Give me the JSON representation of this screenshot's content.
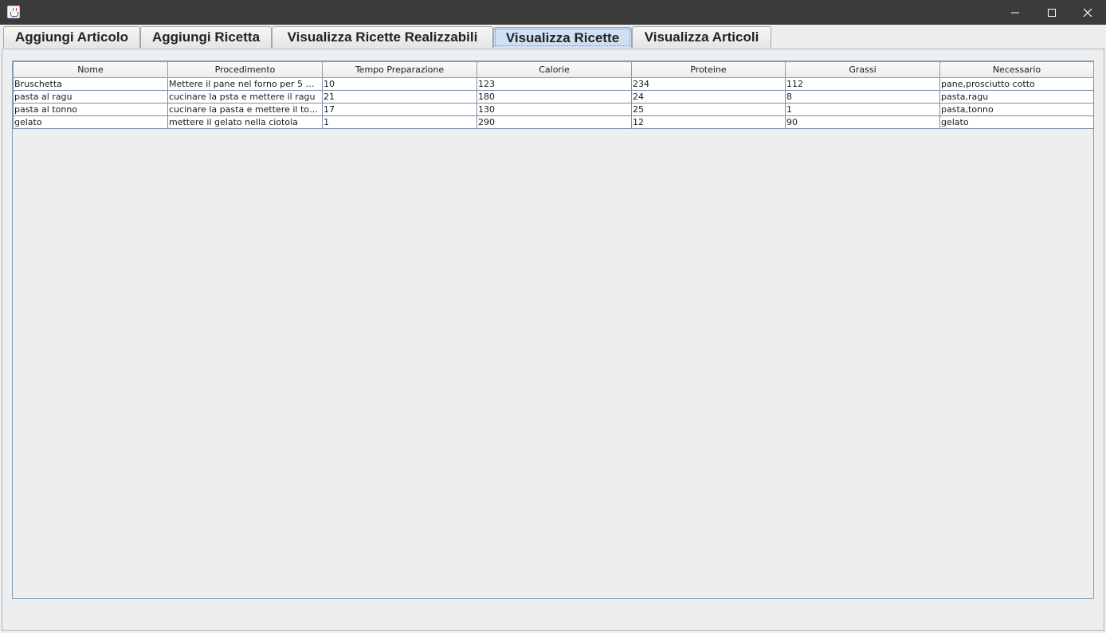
{
  "tabs": [
    {
      "label": "Aggiungi Articolo",
      "selected": false
    },
    {
      "label": "Aggiungi Ricetta",
      "selected": false
    },
    {
      "label": "Visualizza Ricette Realizzabili",
      "selected": false
    },
    {
      "label": "Visualizza Ricette",
      "selected": true
    },
    {
      "label": "Visualizza Articoli",
      "selected": false
    }
  ],
  "table": {
    "columns": [
      "Nome",
      "Procedimento",
      "Tempo Preparazione",
      "Calorie",
      "Proteine",
      "Grassi",
      "Necessario"
    ],
    "rows": [
      [
        "Bruschetta",
        "Mettere il pane nel forno per 5 mi...",
        "10",
        "123",
        "234",
        "112",
        "pane,prosciutto cotto"
      ],
      [
        "pasta al ragu",
        "cucinare la psta e mettere il ragu",
        "21",
        "180",
        "24",
        "8",
        "pasta,ragu"
      ],
      [
        "pasta al tonno",
        "cucinare la pasta e mettere il ton...",
        "17",
        "130",
        "25",
        "1",
        "pasta,tonno"
      ],
      [
        "gelato",
        "mettere il gelato nella ciotola",
        "1",
        "290",
        "12",
        "90",
        "gelato"
      ]
    ]
  },
  "colors": {
    "titlebar": "#3b3b3b",
    "selected_tab": "#cfe0f4",
    "panel_background": "#eeeeee",
    "table_border": "#7a8ca8"
  }
}
